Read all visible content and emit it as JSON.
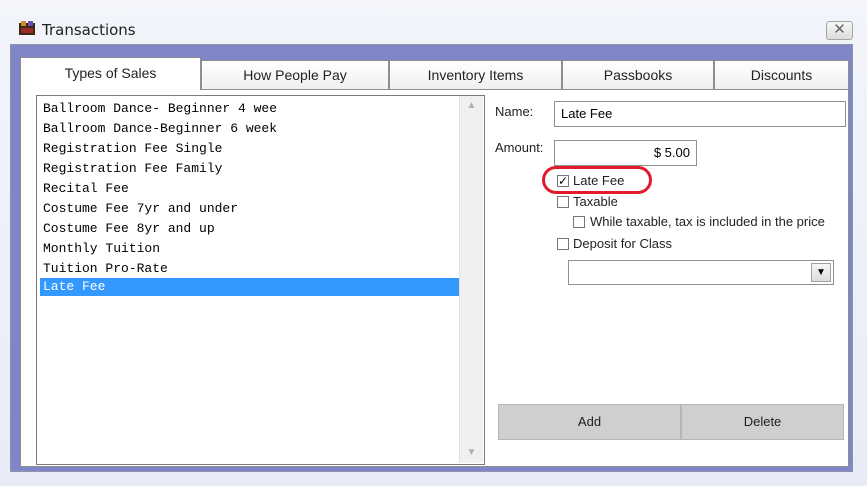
{
  "window": {
    "title": "Transactions",
    "close_glyph": "✕"
  },
  "tabs": [
    {
      "label": "Types of Sales"
    },
    {
      "label": "How People Pay"
    },
    {
      "label": "Inventory Items"
    },
    {
      "label": "Passbooks"
    },
    {
      "label": "Discounts"
    }
  ],
  "list": {
    "items": [
      "Ballroom Dance- Beginner 4 wee",
      "Ballroom Dance-Beginner 6 week",
      "Registration Fee Single",
      "Registration Fee Family",
      "Recital Fee",
      "Costume Fee 7yr and under",
      "Costume Fee 8yr and up",
      "Monthly Tuition",
      "Tuition Pro-Rate",
      "Late Fee"
    ],
    "selected": "Late Fee",
    "scroll_up": "▲",
    "scroll_down": "▼"
  },
  "form": {
    "name_label": "Name:",
    "name_value": "Late Fee",
    "amount_label": "Amount:",
    "amount_value": "$ 5.00",
    "late_fee_label": "Late Fee",
    "late_fee_checked": "✓",
    "taxable_label": "Taxable",
    "tax_included_label": "While taxable, tax is included in the price",
    "deposit_label": "Deposit for Class",
    "class_dropdown_value": "",
    "dropdown_arrow": "▼"
  },
  "buttons": {
    "add": "Add",
    "delete": "Delete"
  },
  "colors": {
    "selection": "#3399ff",
    "highlight_circle": "#e11b2b",
    "frame": "#7e86c7"
  }
}
